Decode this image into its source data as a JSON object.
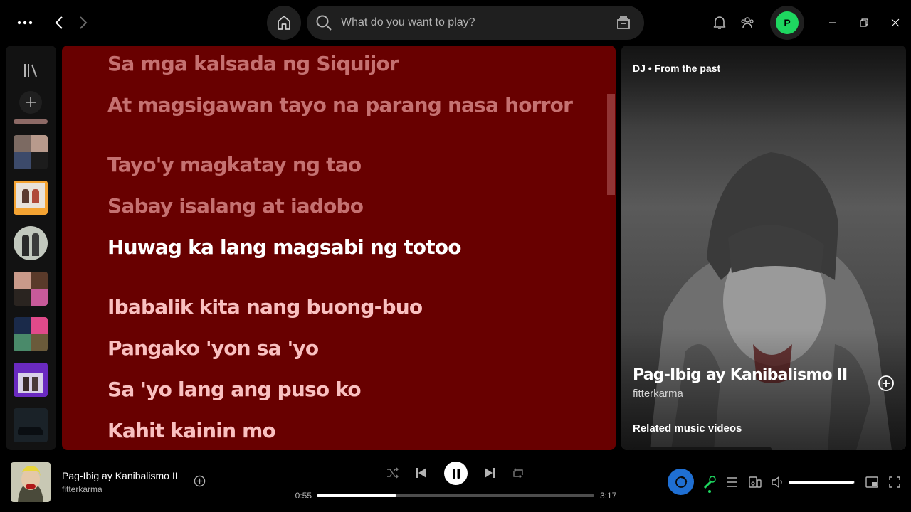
{
  "search": {
    "placeholder": "What do you want to play?"
  },
  "profile": {
    "initial": "P",
    "color": "#1ed760"
  },
  "lyrics": {
    "background": "#680000",
    "lines": [
      {
        "text": "Sa mga kalsada ng Siquijor",
        "state": "past"
      },
      {
        "text": "At magsigawan tayo na parang nasa horror",
        "state": "past"
      },
      {
        "text": "Tayo'y magkatay ng tao",
        "state": "past"
      },
      {
        "text": "Sabay isalang at iadobo",
        "state": "past"
      },
      {
        "text": "Huwag ka lang magsabi ng totoo",
        "state": "current"
      },
      {
        "text": "Ibabalik kita nang buong-buo",
        "state": "future"
      },
      {
        "text": "Pangako 'yon sa 'yo",
        "state": "future"
      },
      {
        "text": "Sa 'yo lang ang puso ko",
        "state": "future"
      },
      {
        "text": "Kahit kainin mo",
        "state": "future"
      }
    ]
  },
  "now_playing": {
    "context": "DJ • From the past",
    "title": "Pag-Ibig ay Kanibalismo II",
    "artist": "fitterkarma",
    "related_heading": "Related music videos"
  },
  "player": {
    "title": "Pag-Ibig ay Kanibalismo II",
    "artist": "fitterkarma",
    "elapsed": "0:55",
    "total": "3:17",
    "progress_fraction": 0.286,
    "volume_fraction": 0.99,
    "dj_color": "#1f6fd3",
    "active_color": "#1ed760"
  },
  "icons": {
    "topbar": [
      "more-icon",
      "chevron-left-icon",
      "chevron-right-icon",
      "home-icon",
      "search-icon",
      "browse-icon",
      "bell-icon",
      "friends-icon"
    ],
    "player": [
      "shuffle-icon",
      "previous-icon",
      "pause-icon",
      "next-icon",
      "repeat-icon",
      "dj-icon",
      "microphone-icon",
      "queue-icon",
      "connect-device-icon",
      "volume-icon",
      "miniplayer-icon",
      "fullscreen-icon"
    ]
  }
}
